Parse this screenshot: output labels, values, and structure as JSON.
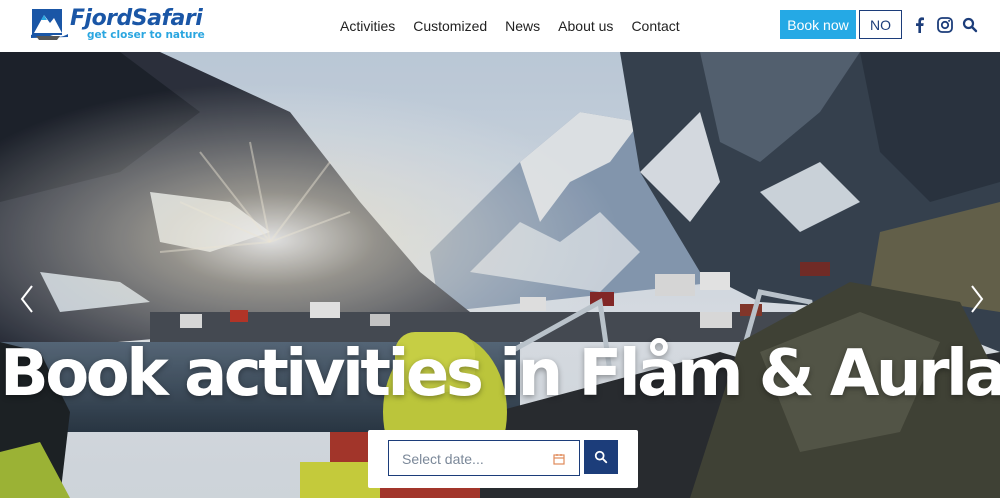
{
  "header": {
    "logo": {
      "name": "FjordSafari",
      "tagline": "get closer to nature"
    },
    "nav": [
      "Activities",
      "Customized",
      "News",
      "About us",
      "Contact"
    ],
    "book_label": "Book now",
    "lang_label": "NO",
    "icons": [
      "facebook-icon",
      "instagram-icon",
      "search-icon"
    ]
  },
  "hero": {
    "title": "Book activities in Flåm & Aurland",
    "date_placeholder": "Select date...",
    "prev_icon": "chevron-left-icon",
    "next_icon": "chevron-right-icon"
  },
  "colors": {
    "accent": "#25a9e5",
    "navy": "#1c3d7a",
    "logo_blue": "#1a56a6",
    "tagline": "#2aa6e0"
  }
}
